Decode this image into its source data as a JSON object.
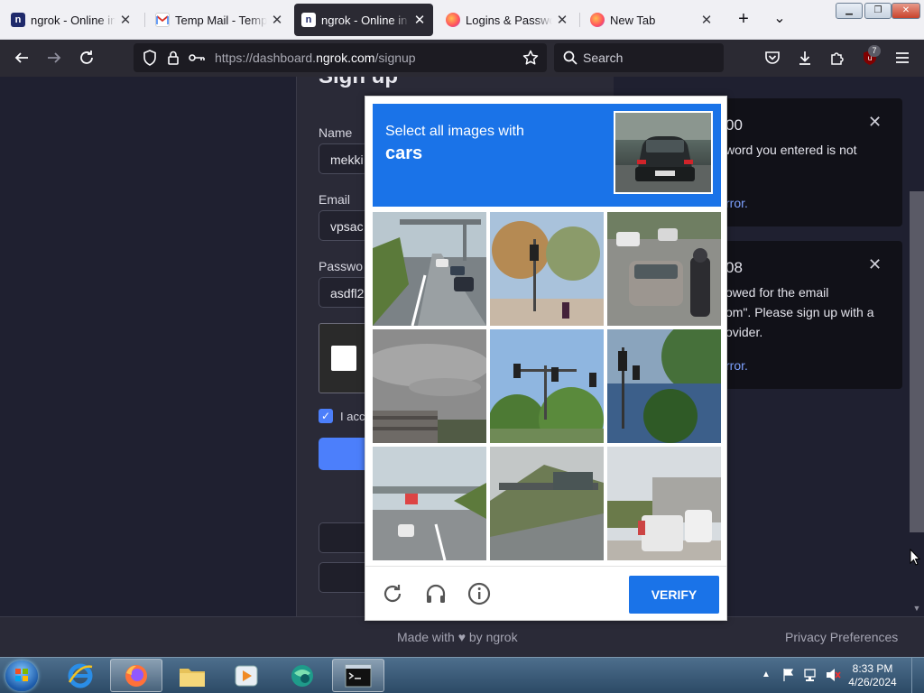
{
  "browser": {
    "tabs": [
      {
        "title": "ngrok - Online in One",
        "favicon": "ngrok-icon"
      },
      {
        "title": "Temp Mail - Temporary",
        "favicon": "gmail-icon"
      },
      {
        "title": "ngrok - Online in One",
        "favicon": "ngrok-icon",
        "active": true
      },
      {
        "title": "Logins & Passwords",
        "favicon": "firefox-icon"
      },
      {
        "title": "New Tab",
        "favicon": "firefox-icon"
      }
    ],
    "close_glyph": "✕",
    "new_tab_glyph": "+",
    "tab_list_glyph": "⌄",
    "url_prefix": "https://dashboard.",
    "url_host": "ngrok.com",
    "url_path": "/signup",
    "search_placeholder": "Search",
    "extension_badge": "7"
  },
  "signup": {
    "title": "Sign up",
    "name_label": "Name",
    "name_value": "mekki",
    "email_label": "Email",
    "email_value": "vpsac",
    "password_label": "Passwo",
    "password_value": "asdfl2",
    "terms_text": "I acc",
    "terms_checked": true
  },
  "toasts": [
    {
      "code": "00",
      "lines": [
        "word you entered is not"
      ],
      "link": "rror."
    },
    {
      "code": "08",
      "lines": [
        "owed for the email",
        "om\". Please sign up with a",
        "ovider."
      ],
      "link": "rror."
    }
  ],
  "captcha": {
    "prompt_line1": "Select all images with",
    "prompt_target": "cars",
    "tiles": [
      "highway-with-cars",
      "street-trees-traffic-light",
      "cars-and-motorcycle",
      "cloudy-sky-building",
      "traffic-lights-trees",
      "traffic-lights-street",
      "highway-overpass-car",
      "road-sign-gantry",
      "vans-on-street"
    ],
    "verify_label": "VERIFY",
    "icons": [
      "reload-icon",
      "audio-challenge-icon",
      "info-icon"
    ]
  },
  "footer": {
    "made_with": "Made with ♥ by ngrok",
    "privacy": "Privacy Preferences"
  },
  "taskbar": {
    "time": "8:33 PM",
    "date": "4/26/2024",
    "apps": [
      "internet-explorer-icon",
      "firefox-icon",
      "file-explorer-icon",
      "media-player-icon",
      "browser-globe-icon",
      "command-prompt-icon"
    ]
  },
  "colors": {
    "captcha_blue": "#1a73e8",
    "ngrok_accent": "#4c7ffb",
    "page_bg": "#1f2030"
  }
}
